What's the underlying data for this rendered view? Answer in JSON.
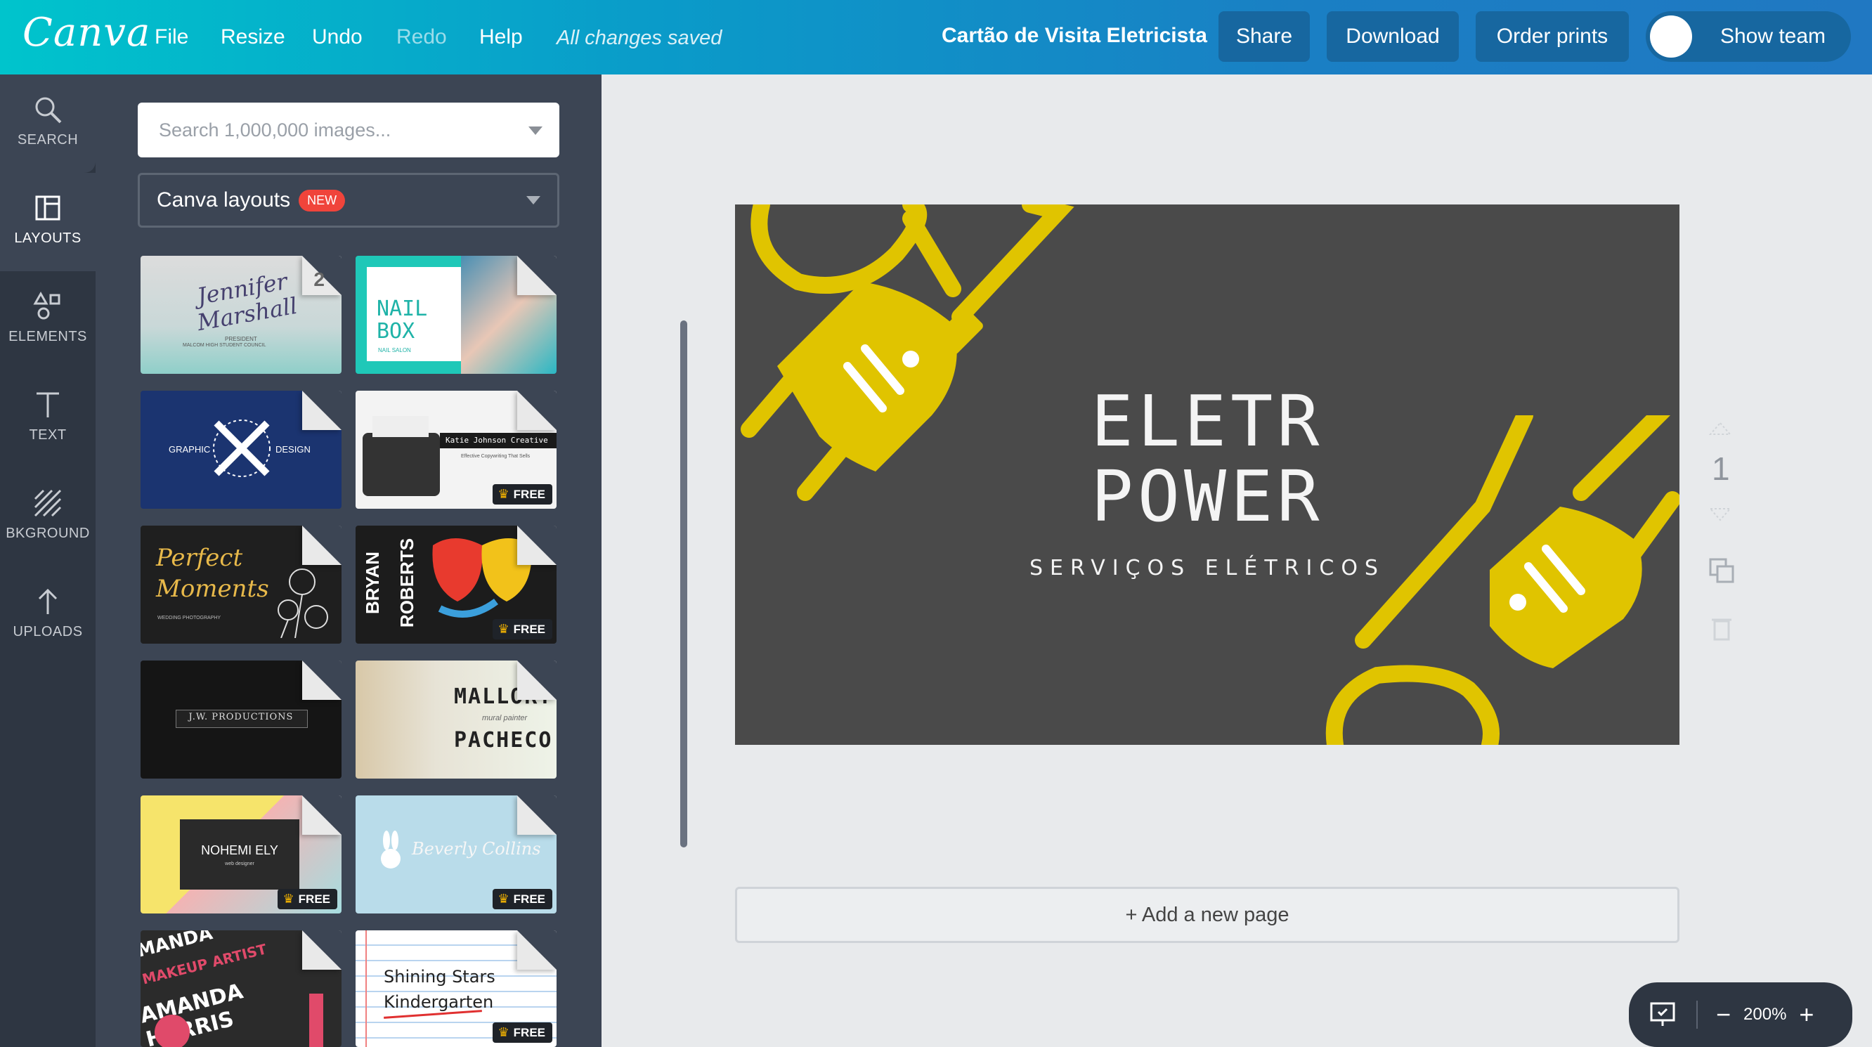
{
  "app": {
    "logo": "Canva"
  },
  "menu": {
    "file": "File",
    "resize": "Resize",
    "undo": "Undo",
    "redo": "Redo",
    "help": "Help",
    "saved_status": "All changes saved"
  },
  "document": {
    "title": "Cartão de Visita Eletricista"
  },
  "actions": {
    "share": "Share",
    "download": "Download",
    "order_prints": "Order prints",
    "show_team": "Show team"
  },
  "sidebar": {
    "items": [
      {
        "label": "SEARCH",
        "icon": "search-icon"
      },
      {
        "label": "LAYOUTS",
        "icon": "layouts-icon"
      },
      {
        "label": "ELEMENTS",
        "icon": "elements-icon"
      },
      {
        "label": "TEXT",
        "icon": "text-icon"
      },
      {
        "label": "BKGROUND",
        "icon": "background-icon"
      },
      {
        "label": "UPLOADS",
        "icon": "upload-icon"
      }
    ]
  },
  "panel": {
    "search_placeholder": "Search 1,000,000 images...",
    "layouts_label": "Canva layouts",
    "new_badge": "NEW",
    "free_label": "FREE",
    "thumbs": {
      "t1": {
        "name1": "Jennifer",
        "name2": "Marshall",
        "sub": "PRESIDENT",
        "sub2": "MALCOM HIGH STUDENT COUNCIL",
        "pages": "2"
      },
      "t2": {
        "line1": "NAIL",
        "line2": "BOX",
        "sub": "NAIL SALON"
      },
      "t3": {
        "left": "GRAPHIC",
        "right": "DESIGN"
      },
      "t4": {
        "title": "Katie Johnson Creative",
        "sub": "Effective Copywriting That Sells"
      },
      "t5": {
        "line1": "Perfect",
        "line2": "Moments",
        "sub": "WEDDING PHOTOGRAPHY"
      },
      "t6": {
        "line1": "BRYAN",
        "line2": "ROBERTS"
      },
      "t7": {
        "title": "J.W. PRODUCTIONS"
      },
      "t8": {
        "line1": "MALLORY",
        "sub": "mural painter",
        "line2": "PACHECO"
      },
      "t9": {
        "title": "NOHEMI ELY",
        "sub": "web designer"
      },
      "t10": {
        "title": "Beverly Collins"
      },
      "t11": {
        "line1": "MANDA",
        "line2": "MAKEUP ARTIST",
        "line3": "AMANDA HARRIS"
      },
      "t12": {
        "line1": "Shining Stars",
        "line2": "Kindergarten"
      }
    }
  },
  "design": {
    "title_line1": "ELETR",
    "title_line2": "POWER",
    "subtitle": "SERVIÇOS ELÉTRICOS",
    "plug_color": "#e0c400",
    "bg_color": "#4a4a4a"
  },
  "page_controls": {
    "page_number": "1"
  },
  "canvas_actions": {
    "add_page": "+ Add a new page"
  },
  "zoom": {
    "level": "200%",
    "minus": "−",
    "plus": "+"
  }
}
